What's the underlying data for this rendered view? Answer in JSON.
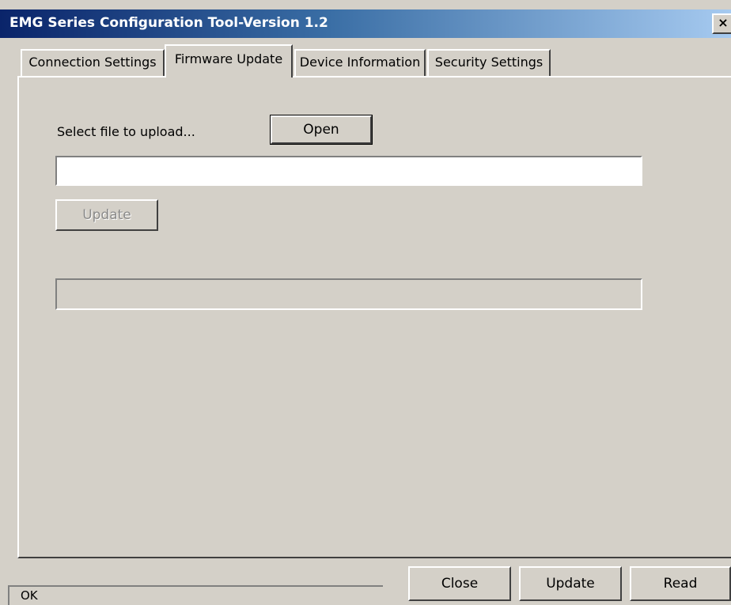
{
  "window": {
    "title": "EMG Series Configuration Tool-Version 1.2",
    "close_symbol": "×",
    "close_icon": "close-icon"
  },
  "tabs": [
    {
      "label": "Connection Settings",
      "active": false
    },
    {
      "label": "Firmware Update",
      "active": true
    },
    {
      "label": "Device Information",
      "active": false
    },
    {
      "label": "Security Settings",
      "active": false
    }
  ],
  "firmware": {
    "select_label": "Select file to upload...",
    "open_label": "Open",
    "file_path": "",
    "update_label": "Update",
    "update_enabled": false,
    "progress": 0
  },
  "footer": {
    "close_label": "Close",
    "update_label": "Update",
    "read_label": "Read"
  },
  "status": {
    "text": "OK"
  },
  "colors": {
    "face": "#d4d0c8",
    "title_start": "#0a246a",
    "title_end": "#a6caf0"
  }
}
